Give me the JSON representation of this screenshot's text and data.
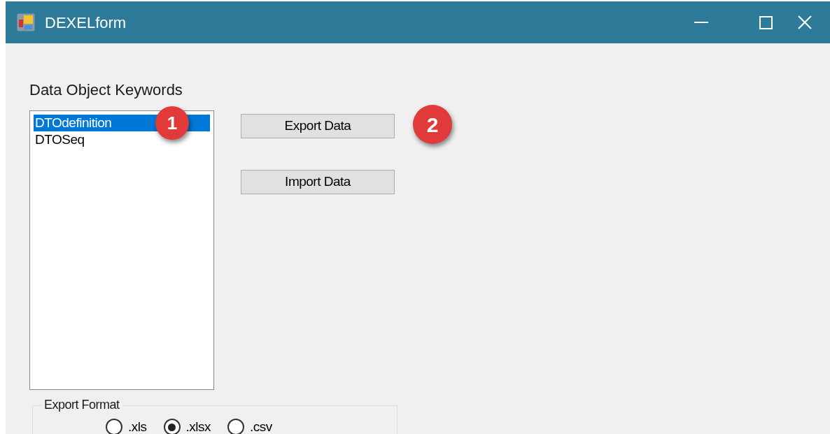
{
  "window": {
    "title": "DEXELform"
  },
  "keywords": {
    "label": "Data Object Keywords",
    "items": [
      {
        "text": "DTOdefinition",
        "selected": true
      },
      {
        "text": "DTOSeq",
        "selected": false
      }
    ]
  },
  "buttons": [
    "Export Data",
    "Import Data"
  ],
  "export_format": {
    "legend": "Export Format",
    "options": [
      {
        "label": ".xls",
        "selected": false
      },
      {
        "label": ".xlsx",
        "selected": true
      },
      {
        "label": ".csv",
        "selected": false
      }
    ]
  },
  "annotations": [
    "1",
    "2"
  ]
}
